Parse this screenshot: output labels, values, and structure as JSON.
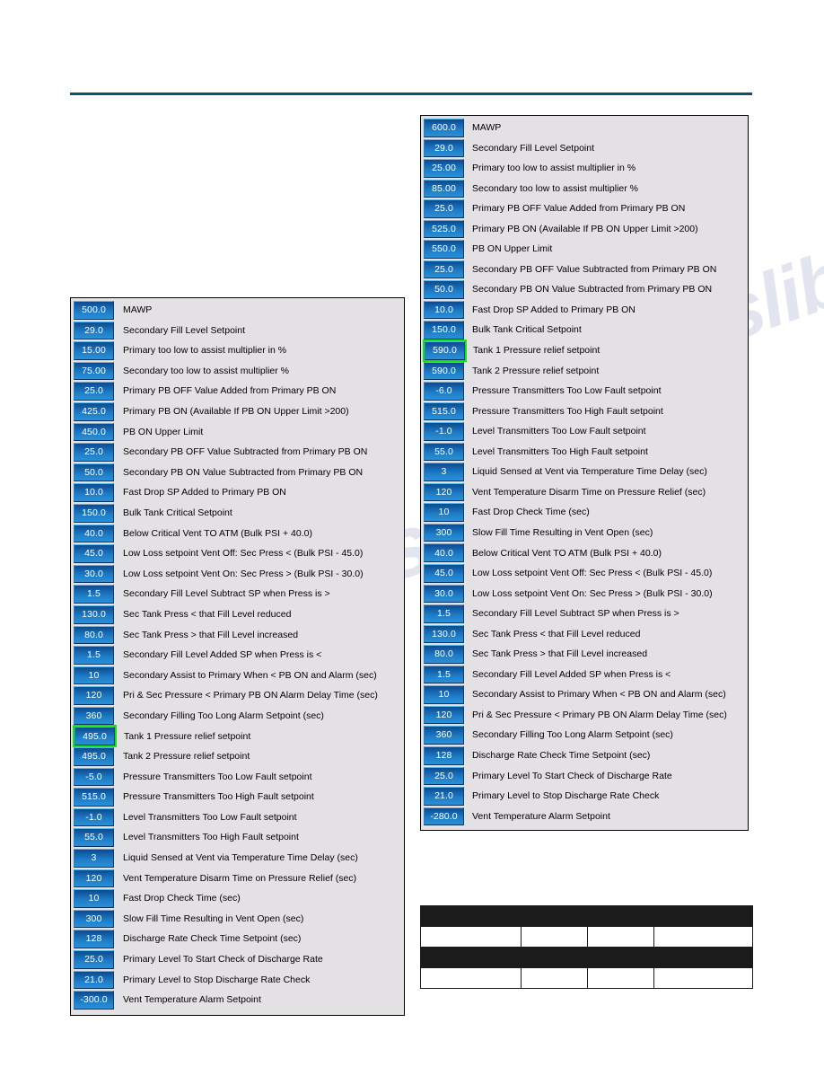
{
  "page": {
    "watermark_text": "manualslib.com"
  },
  "panels": {
    "left": {
      "name": "setpoint-list-500psi",
      "rows": [
        {
          "value": "500.0",
          "label": "MAWP",
          "selected": false
        },
        {
          "value": "29.0",
          "label": "Secondary Fill Level Setpoint",
          "selected": false
        },
        {
          "value": "15.00",
          "label": "Primary too low to assist multiplier in %",
          "selected": false
        },
        {
          "value": "75.00",
          "label": "Secondary too low to assist multiplier %",
          "selected": false
        },
        {
          "value": "25.0",
          "label": "Primary PB OFF Value Added from Primary PB ON",
          "selected": false
        },
        {
          "value": "425.0",
          "label": "Primary PB ON (Available If PB ON Upper Limit >200)",
          "selected": false
        },
        {
          "value": "450.0",
          "label": "PB ON Upper Limit",
          "selected": false
        },
        {
          "value": "25.0",
          "label": "Secondary PB OFF Value Subtracted from Primary PB ON",
          "selected": false
        },
        {
          "value": "50.0",
          "label": "Secondary PB ON Value Subtracted from Primary PB ON",
          "selected": false
        },
        {
          "value": "10.0",
          "label": "Fast Drop SP Added to Primary PB ON",
          "selected": false
        },
        {
          "value": "150.0",
          "label": "Bulk Tank Critical Setpoint",
          "selected": false
        },
        {
          "value": "40.0",
          "label": "Below Critical Vent TO ATM (Bulk PSI + 40.0)",
          "selected": false
        },
        {
          "value": "45.0",
          "label": "Low Loss setpoint Vent Off: Sec Press < (Bulk PSI - 45.0)",
          "selected": false
        },
        {
          "value": "30.0",
          "label": "Low Loss setpoint Vent On: Sec Press > (Bulk PSI - 30.0)",
          "selected": false
        },
        {
          "value": "1.5",
          "label": "Secondary Fill Level Subtract SP when Press is >",
          "selected": false
        },
        {
          "value": "130.0",
          "label": "Sec Tank Press < that Fill Level reduced",
          "selected": false
        },
        {
          "value": "80.0",
          "label": "Sec Tank Press > that Fill Level increased",
          "selected": false
        },
        {
          "value": "1.5",
          "label": "Secondary Fill Level Added SP when Press is <",
          "selected": false
        },
        {
          "value": "10",
          "label": "Secondary Assist to Primary When < PB ON and Alarm (sec)",
          "selected": false
        },
        {
          "value": "120",
          "label": "Pri & Sec Pressure < Primary PB ON Alarm Delay Time (sec)",
          "selected": false
        },
        {
          "value": "360",
          "label": "Secondary Filling Too Long Alarm Setpoint (sec)",
          "selected": false
        },
        {
          "value": "495.0",
          "label": "Tank 1 Pressure relief setpoint",
          "selected": true
        },
        {
          "value": "495.0",
          "label": "Tank 2 Pressure relief setpoint",
          "selected": false
        },
        {
          "value": "-5.0",
          "label": "Pressure Transmitters Too Low Fault setpoint",
          "selected": false
        },
        {
          "value": "515.0",
          "label": "Pressure Transmitters Too High Fault setpoint",
          "selected": false
        },
        {
          "value": "-1.0",
          "label": "Level Transmitters Too Low Fault setpoint",
          "selected": false
        },
        {
          "value": "55.0",
          "label": "Level Transmitters Too High Fault setpoint",
          "selected": false
        },
        {
          "value": "3",
          "label": "Liquid Sensed at Vent via Temperature Time Delay (sec)",
          "selected": false
        },
        {
          "value": "120",
          "label": "Vent Temperature Disarm Time on Pressure Relief (sec)",
          "selected": false
        },
        {
          "value": "10",
          "label": "Fast Drop Check Time (sec)",
          "selected": false
        },
        {
          "value": "300",
          "label": "Slow Fill Time Resulting in Vent Open (sec)",
          "selected": false
        },
        {
          "value": "128",
          "label": "Discharge Rate Check Time Setpoint (sec)",
          "selected": false
        },
        {
          "value": "25.0",
          "label": "Primary Level To Start Check of Discharge Rate",
          "selected": false
        },
        {
          "value": "21.0",
          "label": "Primary Level to Stop Discharge Rate Check",
          "selected": false
        },
        {
          "value": "-300.0",
          "label": "Vent Temperature Alarm Setpoint",
          "selected": false
        }
      ]
    },
    "right": {
      "name": "setpoint-list-600psi",
      "rows": [
        {
          "value": "600.0",
          "label": "MAWP",
          "selected": false
        },
        {
          "value": "29.0",
          "label": "Secondary Fill Level Setpoint",
          "selected": false
        },
        {
          "value": "25.00",
          "label": "Primary too low to assist multiplier in %",
          "selected": false
        },
        {
          "value": "85.00",
          "label": "Secondary too low to assist multiplier %",
          "selected": false
        },
        {
          "value": "25.0",
          "label": "Primary PB OFF Value Added from Primary PB ON",
          "selected": false
        },
        {
          "value": "525.0",
          "label": "Primary PB ON (Available If PB ON Upper Limit >200)",
          "selected": false
        },
        {
          "value": "550.0",
          "label": "PB ON Upper Limit",
          "selected": false
        },
        {
          "value": "25.0",
          "label": "Secondary PB OFF Value Subtracted from Primary PB ON",
          "selected": false
        },
        {
          "value": "50.0",
          "label": "Secondary PB ON Value Subtracted from Primary PB ON",
          "selected": false
        },
        {
          "value": "10.0",
          "label": "Fast Drop SP Added to Primary PB ON",
          "selected": false
        },
        {
          "value": "150.0",
          "label": "Bulk Tank Critical Setpoint",
          "selected": false
        },
        {
          "value": "590.0",
          "label": "Tank 1 Pressure relief setpoint",
          "selected": true
        },
        {
          "value": "590.0",
          "label": "Tank 2 Pressure relief setpoint",
          "selected": false
        },
        {
          "value": "-6.0",
          "label": "Pressure Transmitters Too Low Fault setpoint",
          "selected": false
        },
        {
          "value": "515.0",
          "label": "Pressure Transmitters Too High Fault setpoint",
          "selected": false
        },
        {
          "value": "-1.0",
          "label": "Level Transmitters Too Low Fault setpoint",
          "selected": false
        },
        {
          "value": "55.0",
          "label": "Level Transmitters Too High Fault setpoint",
          "selected": false
        },
        {
          "value": "3",
          "label": "Liquid Sensed at Vent via Temperature Time Delay (sec)",
          "selected": false
        },
        {
          "value": "120",
          "label": "Vent Temperature Disarm Time on Pressure Relief (sec)",
          "selected": false
        },
        {
          "value": "10",
          "label": "Fast Drop Check Time (sec)",
          "selected": false
        },
        {
          "value": "300",
          "label": "Slow Fill Time Resulting in Vent Open (sec)",
          "selected": false
        },
        {
          "value": "40.0",
          "label": "Below Critical Vent TO ATM (Bulk PSI + 40.0)",
          "selected": false
        },
        {
          "value": "45.0",
          "label": "Low Loss setpoint Vent Off: Sec Press < (Bulk PSI - 45.0)",
          "selected": false
        },
        {
          "value": "30.0",
          "label": "Low Loss setpoint Vent On: Sec Press > (Bulk PSI - 30.0)",
          "selected": false
        },
        {
          "value": "1.5",
          "label": "Secondary Fill Level Subtract SP when Press is >",
          "selected": false
        },
        {
          "value": "130.0",
          "label": "Sec Tank Press < that Fill Level reduced",
          "selected": false
        },
        {
          "value": "80.0",
          "label": "Sec Tank Press > that Fill Level increased",
          "selected": false
        },
        {
          "value": "1.5",
          "label": "Secondary Fill Level Added SP when Press is <",
          "selected": false
        },
        {
          "value": "10",
          "label": "Secondary Assist to Primary When < PB ON and Alarm (sec)",
          "selected": false
        },
        {
          "value": "120",
          "label": "Pri & Sec Pressure < Primary PB ON Alarm Delay Time (sec)",
          "selected": false
        },
        {
          "value": "360",
          "label": "Secondary Filling Too Long Alarm Setpoint (sec)",
          "selected": false
        },
        {
          "value": "128",
          "label": "Discharge Rate Check Time Setpoint (sec)",
          "selected": false
        },
        {
          "value": "25.0",
          "label": "Primary Level To Start Check of Discharge Rate",
          "selected": false
        },
        {
          "value": "21.0",
          "label": "Primary Level to Stop Discharge Rate Check",
          "selected": false
        },
        {
          "value": "-280.0",
          "label": "Vent Temperature Alarm Setpoint",
          "selected": false
        }
      ]
    }
  },
  "redacted_table": {
    "rows": [
      {
        "kind": "band",
        "cells": [
          "",
          "",
          "",
          ""
        ]
      },
      {
        "kind": "cells",
        "cells": [
          "",
          "",
          "",
          ""
        ]
      },
      {
        "kind": "band",
        "cells": [
          "",
          "",
          "",
          ""
        ]
      },
      {
        "kind": "cells",
        "cells": [
          "",
          "",
          "",
          ""
        ]
      }
    ]
  },
  "colors": {
    "rule": "#0d4f6c",
    "panel_bg": "#e4e1e4",
    "chip_blue_dark": "#0b4a8c",
    "chip_blue_light": "#2a90d6",
    "selection_green": "#13e513",
    "redaction_black": "#1b1b1b"
  }
}
